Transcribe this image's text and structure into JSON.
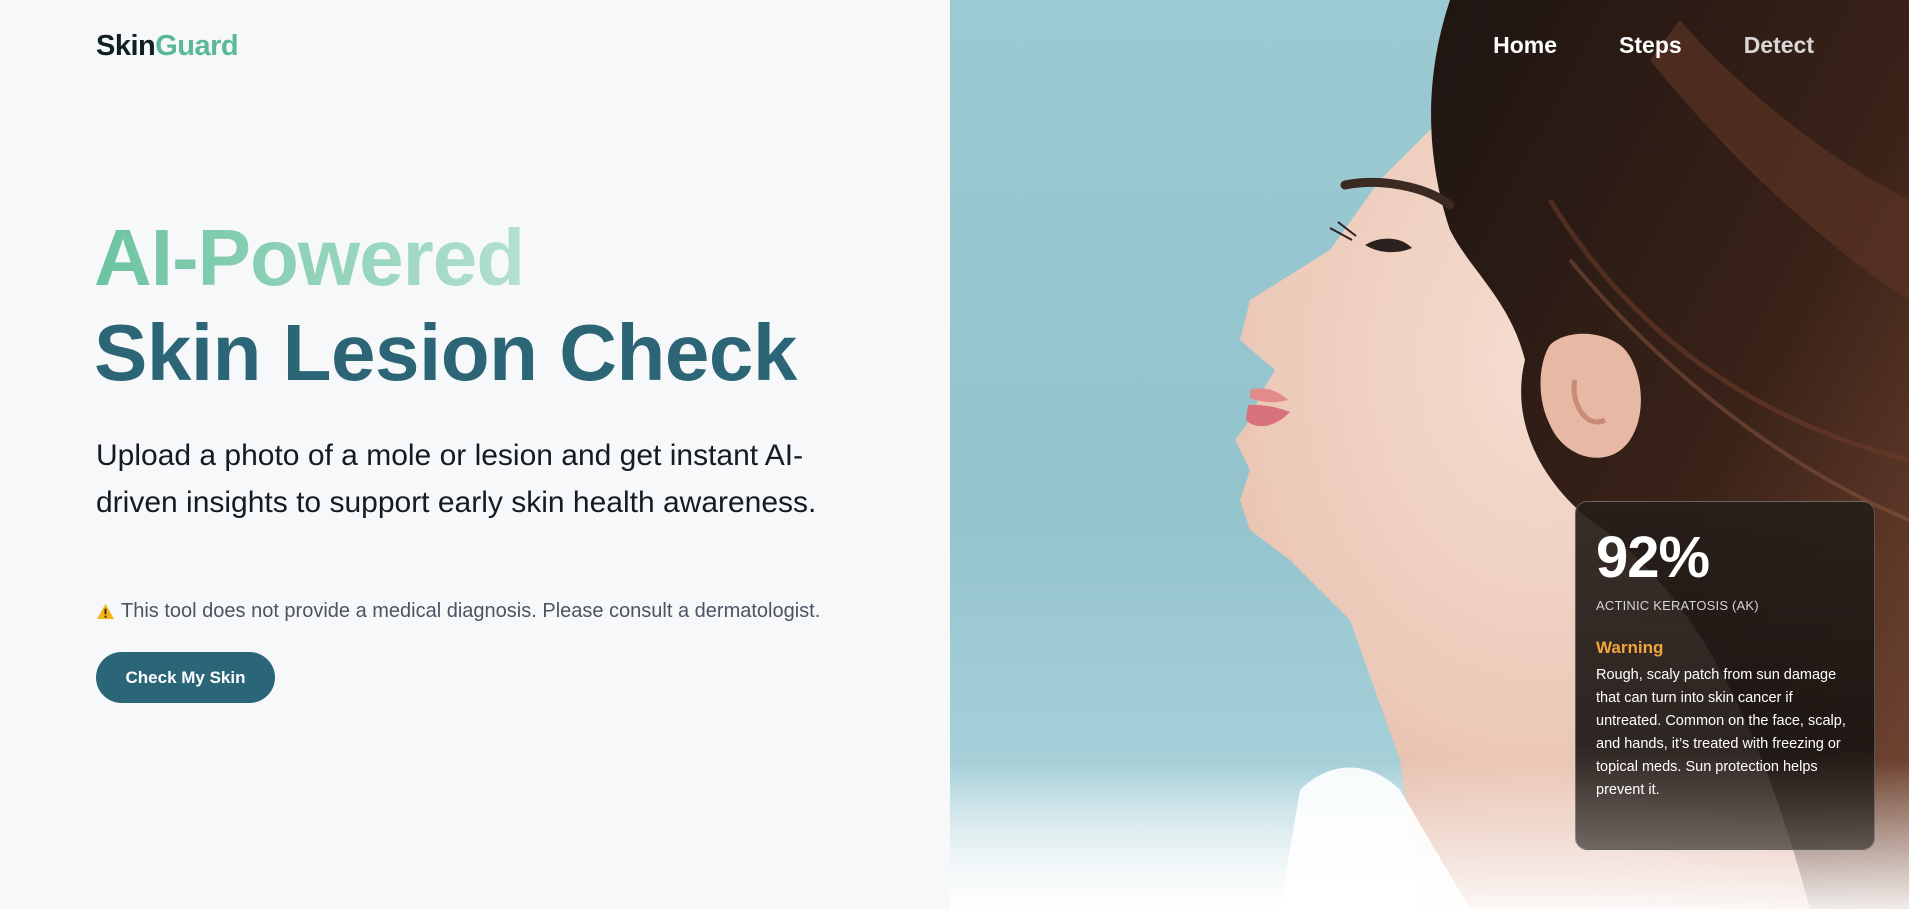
{
  "brand": {
    "name_part1": "Skin",
    "name_part2": "Guard",
    "accent_color": "#5cb89a"
  },
  "nav": {
    "items": [
      "Home",
      "Steps",
      "Detect"
    ]
  },
  "hero": {
    "title_line1": "AI-Powered",
    "title_line2": "Skin Lesion Check",
    "subtitle": "Upload a photo of a mole or lesion and get instant AI-driven insights to support early skin health awareness.",
    "disclaimer": "This tool does not provide a medical diagnosis. Please consult a dermatologist.",
    "disclaimer_icon": "warning-triangle-icon",
    "cta_label": "Check My Skin"
  },
  "result": {
    "confidence": "92%",
    "condition": "ACTINIC KERATOSIS (AK)",
    "level": "Warning",
    "level_color": "#f2a53a",
    "description": "Rough, scaly patch from sun damage that can turn into skin cancer if untreated. Common on the face, scalp, and hands, it’s treated with freezing or topical meds. Sun protection helps prevent it."
  },
  "colors": {
    "primary": "#2a6677",
    "title_gradient_start": "#6cc4a1",
    "background": "#f7f8fa"
  }
}
